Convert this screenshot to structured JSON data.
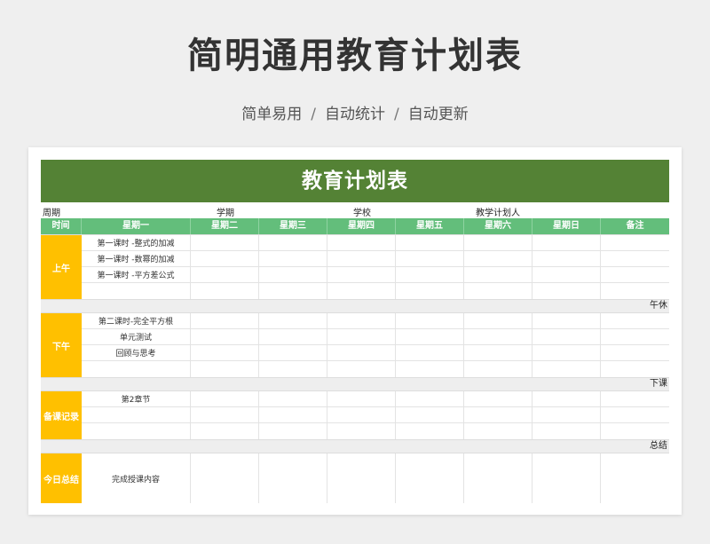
{
  "title": "简明通用教育计划表",
  "subtitle": {
    "part1": "简单易用",
    "part2": "自动统计",
    "part3": "自动更新",
    "sep": "/"
  },
  "sheet": {
    "banner": "教育计划表",
    "info": {
      "week": "周期",
      "term": "学期",
      "school": "学校",
      "planner": "教学计划人"
    },
    "headers": [
      "时间",
      "星期一",
      "星期二",
      "星期三",
      "星期四",
      "星期五",
      "星期六",
      "星期日",
      "备注"
    ],
    "blocks": [
      {
        "label": "上午",
        "rows": [
          "第一课时 -整式的加减",
          "第一课时 -数幂的加减",
          "第一课时 -平方差公式",
          ""
        ],
        "after": "午休"
      },
      {
        "label": "下午",
        "rows": [
          "第二课时-完全平方根",
          "单元测试",
          "回顾与思考",
          ""
        ],
        "after": "下课"
      },
      {
        "label": "备课记录",
        "rows": [
          "第2章节",
          "",
          ""
        ],
        "after": "总结"
      },
      {
        "label": "今日总结",
        "rows": [
          "完成授课内容"
        ],
        "after": ""
      }
    ]
  },
  "colors": {
    "banner": "#548235",
    "header": "#63be7b",
    "label": "#ffc000"
  }
}
